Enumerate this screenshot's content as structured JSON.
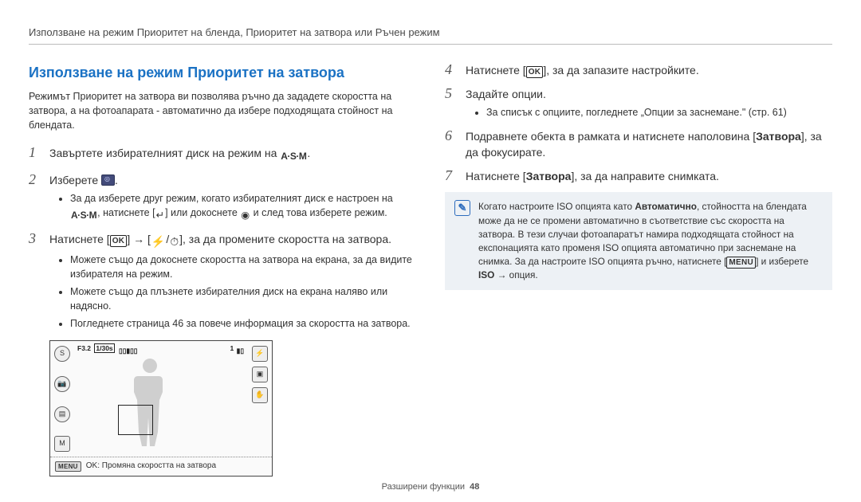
{
  "header": {
    "breadcrumb": "Използване на режим Приоритет на бленда, Приоритет на затвора или Ръчен режим"
  },
  "footer": {
    "section": "Разширени функции",
    "page": "48"
  },
  "left": {
    "title": "Използване на режим Приоритет на затвора",
    "lead": "Режимът Приоритет на затвора ви позволява ръчно да зададете скоростта на затвора, а на фотоапарата - автоматично да избере подходящата стойност на блендата.",
    "step1_pre": "Завъртете избирателният диск на режим на ",
    "step1_post": ".",
    "step2_pre": "Изберете ",
    "step2_post": ".",
    "step2_b1_a": "За да изберете друг режим, когато избирателният диск е настроен на ",
    "step2_b1_b": ", натиснете [",
    "step2_b1_c": "] или докоснете ",
    "step2_b1_d": " и след това изберете режим.",
    "step3_a": "Натиснете [",
    "step3_b": "] → [",
    "step3_c": "/",
    "step3_d": "], за да промените скоростта на затвора.",
    "step3_b1": "Можете също да докоснете скоростта на затвора на екрана, за да видите избирателя на режим.",
    "step3_b2": "Можете също да плъзнете избирателния диск на екрана наляво или надясно.",
    "step3_b3": "Погледнете страница 46 за повече информация за скоростта на затвора.",
    "preview": {
      "aperture": "F3.2",
      "shutter": "1/30s",
      "shots": "1",
      "menu_label": "MENU",
      "footer_text": "OK: Промяна скоростта на затвора"
    }
  },
  "right": {
    "step4_a": "Натиснете [",
    "step4_b": "], за да запазите настройките.",
    "step5": "Задайте опции.",
    "step5_b1": "За списък с опциите, погледнете „Опции за заснемане.\" (стр. 61)",
    "step6_a": "Подравнете обекта в рамката и натиснете наполовина [",
    "step6_b": "], за да фокусирате.",
    "step6_bold": "Затвора",
    "step7_a": "Натиснете [",
    "step7_b": "], за да направите снимката.",
    "step7_bold": "Затвора",
    "note_a": "Когато настроите ISO опцията като ",
    "note_auto": "Автоматично",
    "note_b": ", стойността на блендата може да не се промени автоматично в съответствие със скоростта на затвора. В тези случаи фотоапаратът намира подходящата стойност на експонацията като променя ISO опцията автоматично при заснемане на снимка. За да настроите ISO опцията ръчно, натиснете [",
    "note_c": "] и изберете ",
    "note_iso": "ISO",
    "note_d": " → опция."
  },
  "labels": {
    "ok": "OK",
    "menu": "MENU",
    "asm": "A·S·M"
  }
}
